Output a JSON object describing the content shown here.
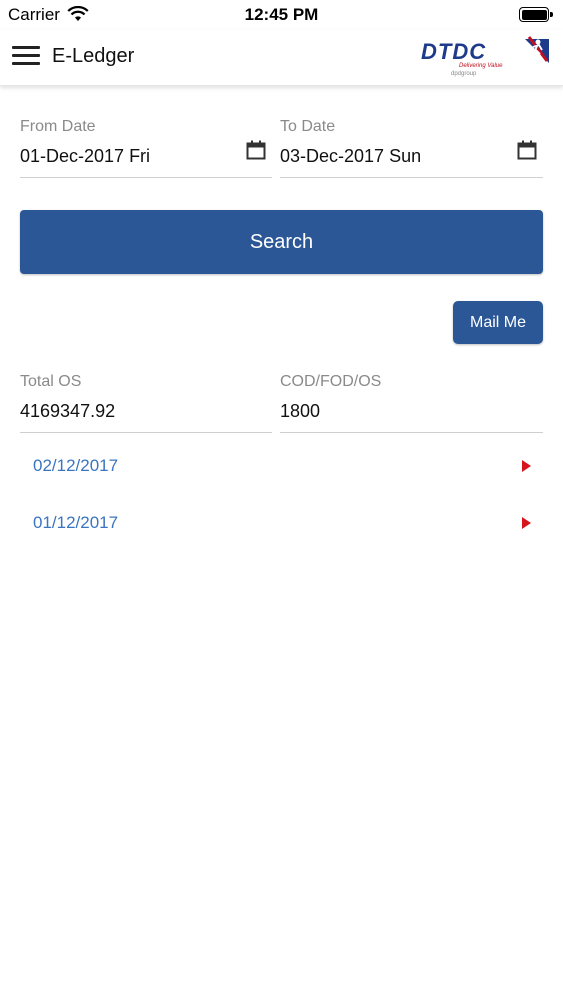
{
  "status_bar": {
    "carrier": "Carrier",
    "time": "12:45 PM"
  },
  "header": {
    "title": "E-Ledger",
    "logo": {
      "brand": "DTDC",
      "tagline": "Delivering Value",
      "partner": "dpdgroup",
      "brand_color": "#1e3a8a",
      "accent_color": "#c0101e"
    }
  },
  "filters": {
    "from_date": {
      "label": "From Date",
      "value": "01-Dec-2017 Fri",
      "icon": "calendar-icon"
    },
    "to_date": {
      "label": "To Date",
      "value": "03-Dec-2017 Sun",
      "icon": "calendar-icon"
    }
  },
  "actions": {
    "search_label": "Search",
    "mail_label": "Mail Me",
    "button_color": "#2b5797"
  },
  "summary": {
    "total_os": {
      "label": "Total OS",
      "value": "4169347.92"
    },
    "cod_fod_os": {
      "label": "COD/FOD/OS",
      "value": "1800"
    }
  },
  "entries": [
    {
      "date": "02/12/2017",
      "icon": "chevron-right-icon"
    },
    {
      "date": "01/12/2017",
      "icon": "chevron-right-icon"
    }
  ],
  "colors": {
    "link": "#3b74c0",
    "chevron": "#d6141e"
  }
}
